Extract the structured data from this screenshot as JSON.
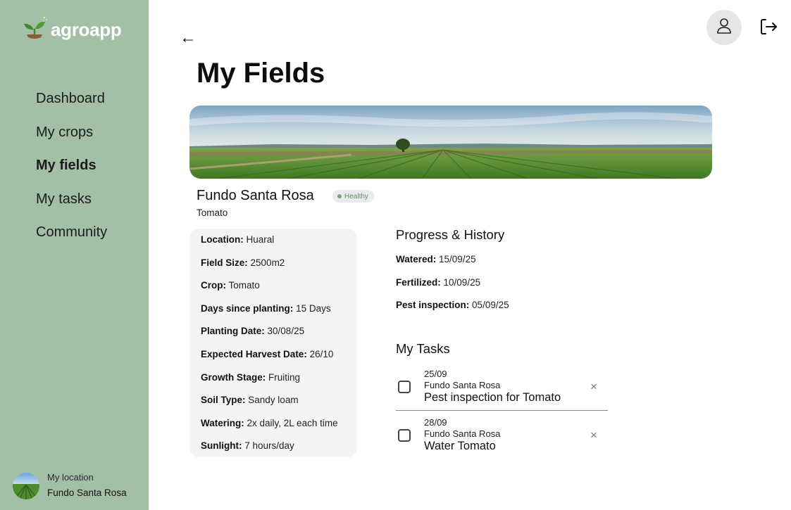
{
  "app": {
    "name": "agroapp"
  },
  "nav": {
    "items": [
      {
        "label": "Dashboard"
      },
      {
        "label": "My crops"
      },
      {
        "label": "My fields"
      },
      {
        "label": "My tasks"
      },
      {
        "label": "Community"
      }
    ],
    "active": "My fields"
  },
  "location": {
    "label": "My location",
    "name": "Fundo Santa Rosa"
  },
  "header": {
    "back_icon": "←",
    "title": "My Fields"
  },
  "field": {
    "name": "Fundo Santa Rosa",
    "status": "Healthy",
    "crop": "Tomato",
    "details": [
      {
        "label": "Location:",
        "value": "Huaral"
      },
      {
        "label": "Field Size:",
        "value": "2500m2"
      },
      {
        "label": "Crop:",
        "value": "Tomato"
      },
      {
        "label": "Days since planting:",
        "value": "15 Days"
      },
      {
        "label": "Planting Date:",
        "value": "30/08/25"
      },
      {
        "label": "Expected Harvest Date:",
        "value": "26/10"
      },
      {
        "label": "Growth Stage:",
        "value": "Fruiting"
      },
      {
        "label": "Soil Type:",
        "value": "Sandy loam"
      },
      {
        "label": "Watering:",
        "value": "2x daily, 2L each time"
      },
      {
        "label": "Sunlight:",
        "value": "7 hours/day"
      }
    ]
  },
  "history": {
    "title": "Progress & History",
    "items": [
      {
        "label": "Watered:",
        "value": "15/09/25"
      },
      {
        "label": "Fertilized:",
        "value": "10/09/25"
      },
      {
        "label": "Pest inspection:",
        "value": "05/09/25"
      }
    ]
  },
  "tasks": {
    "title": "My Tasks",
    "items": [
      {
        "date": "25/09",
        "field": "Fundo Santa Rosa",
        "name": "Pest inspection for Tomato",
        "checked": false
      },
      {
        "date": "28/09",
        "field": "Fundo Santa Rosa",
        "name": "Water Tomato",
        "checked": false
      }
    ],
    "close_icon": "×"
  },
  "icons": {
    "logo": "sprout-icon",
    "back": "arrow-left-icon",
    "user": "user-icon",
    "logout": "logout-icon",
    "close": "close-icon"
  },
  "colors": {
    "sidebar": "#a3bfa6",
    "badge_text": "#6f8a72",
    "badge_bg": "#e9ecea"
  }
}
